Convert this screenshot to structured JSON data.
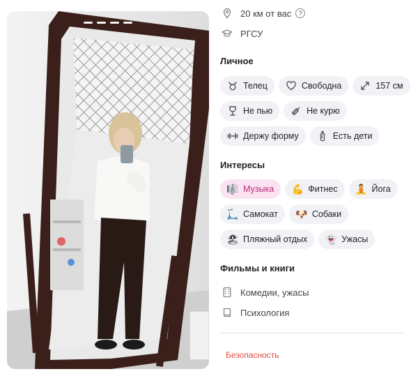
{
  "profile": {
    "distance_text": "20 км от вас",
    "distance_help": "?",
    "education": "РГСУ"
  },
  "personal": {
    "title": "Личное",
    "chips": [
      {
        "label": "Телец",
        "icon": "taurus-icon"
      },
      {
        "label": "Свободна",
        "icon": "heart-outline-icon"
      },
      {
        "label": "157 см",
        "icon": "height-arrows-icon"
      },
      {
        "label": "Не пью",
        "icon": "wine-glass-icon"
      },
      {
        "label": "Не курю",
        "icon": "no-smoking-icon"
      },
      {
        "label": "Держу форму",
        "icon": "dumbbell-icon"
      },
      {
        "label": "Есть дети",
        "icon": "baby-bottle-icon"
      }
    ]
  },
  "interests": {
    "title": "Интересы",
    "chips": [
      {
        "label": "Музыка",
        "icon": "🎼",
        "selected": true
      },
      {
        "label": "Фитнес",
        "icon": "💪"
      },
      {
        "label": "Йога",
        "icon": "🧘"
      },
      {
        "label": "Самокат",
        "icon": "🛴"
      },
      {
        "label": "Собаки",
        "icon": "🐶"
      },
      {
        "label": "Пляжный отдых",
        "icon": "🏖"
      },
      {
        "label": "Ужасы",
        "icon": "👻"
      }
    ]
  },
  "films_books": {
    "title": "Фильмы и книги",
    "items": [
      {
        "label": "Комедии, ужасы",
        "icon": "film-icon"
      },
      {
        "label": "Психология",
        "icon": "book-icon"
      }
    ]
  },
  "footer": {
    "safety_link": "Безопасность"
  },
  "colors": {
    "chip_bg": "#f1f2f5",
    "active_chip_bg": "#fbe3f1",
    "active_chip_text": "#c0287c",
    "link_red": "#e14a3d"
  },
  "photo": {
    "story_count": 4,
    "story_current": 1
  }
}
